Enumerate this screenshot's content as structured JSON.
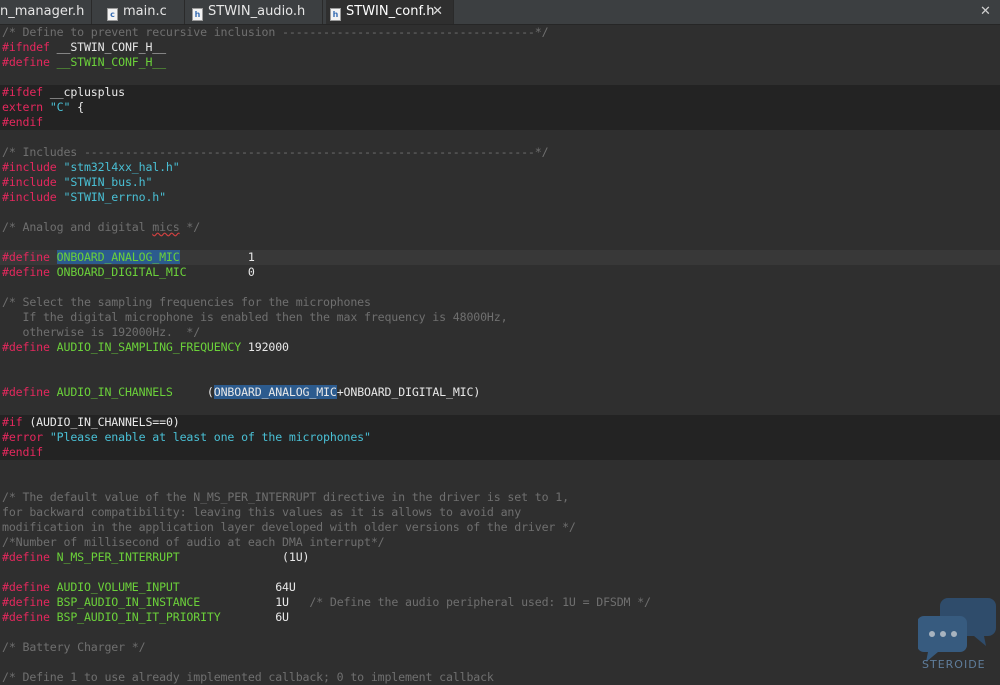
{
  "tabs": [
    {
      "label": "n_manager.h",
      "icon": "h"
    },
    {
      "label": "main.c",
      "icon": "c"
    },
    {
      "label": "STWIN_audio.h",
      "icon": "h"
    },
    {
      "label": "STWIN_conf.h",
      "icon": "h",
      "active": true
    }
  ],
  "editor": {
    "lines": [
      "/* Define to prevent recursive inclusion -------------------------------------*/",
      "#ifndef __STWIN_CONF_H__",
      "#define __STWIN_CONF_H__",
      "",
      "#ifdef __cplusplus",
      "extern \"C\" {",
      "#endif",
      "",
      "/* Includes ------------------------------------------------------------------*/",
      "#include \"stm32l4xx_hal.h\"",
      "#include \"STWIN_bus.h\"",
      "#include \"STWIN_errno.h\"",
      "",
      "/* Analog and digital mics */",
      "",
      "#define ONBOARD_ANALOG_MIC          1",
      "#define ONBOARD_DIGITAL_MIC         0",
      "",
      "/* Select the sampling frequencies for the microphones",
      "   If the digital microphone is enabled then the max frequency is 48000Hz,",
      "   otherwise is 192000Hz.  */",
      "#define AUDIO_IN_SAMPLING_FREQUENCY 192000",
      "",
      "",
      "#define AUDIO_IN_CHANNELS     (ONBOARD_ANALOG_MIC+ONBOARD_DIGITAL_MIC)",
      "",
      "#if (AUDIO_IN_CHANNELS==0)",
      "#error \"Please enable at least one of the microphones\"",
      "#endif",
      "",
      "",
      "/* The default value of the N_MS_PER_INTERRUPT directive in the driver is set to 1,",
      "for backward compatibility: leaving this values as it is allows to avoid any",
      "modification in the application layer developed with older versions of the driver */",
      "/*Number of millisecond of audio at each DMA interrupt*/",
      "#define N_MS_PER_INTERRUPT               (1U)",
      "",
      "#define AUDIO_VOLUME_INPUT              64U",
      "#define BSP_AUDIO_IN_INSTANCE           1U   /* Define the audio peripheral used: 1U = DFSDM */",
      "#define BSP_AUDIO_IN_IT_PRIORITY        6U",
      "",
      "/* Battery Charger */",
      "",
      "/* Define 1 to use already implemented callback; 0 to implement callback"
    ]
  },
  "watermark": {
    "text": "STEROIDE"
  },
  "colors": {
    "background": "#2f2f2f",
    "preprocessor": "#e3285d",
    "macro": "#6bd13a",
    "string": "#49bfd4",
    "comment": "#6f6f6f",
    "highlight": "#2c5b8e"
  }
}
